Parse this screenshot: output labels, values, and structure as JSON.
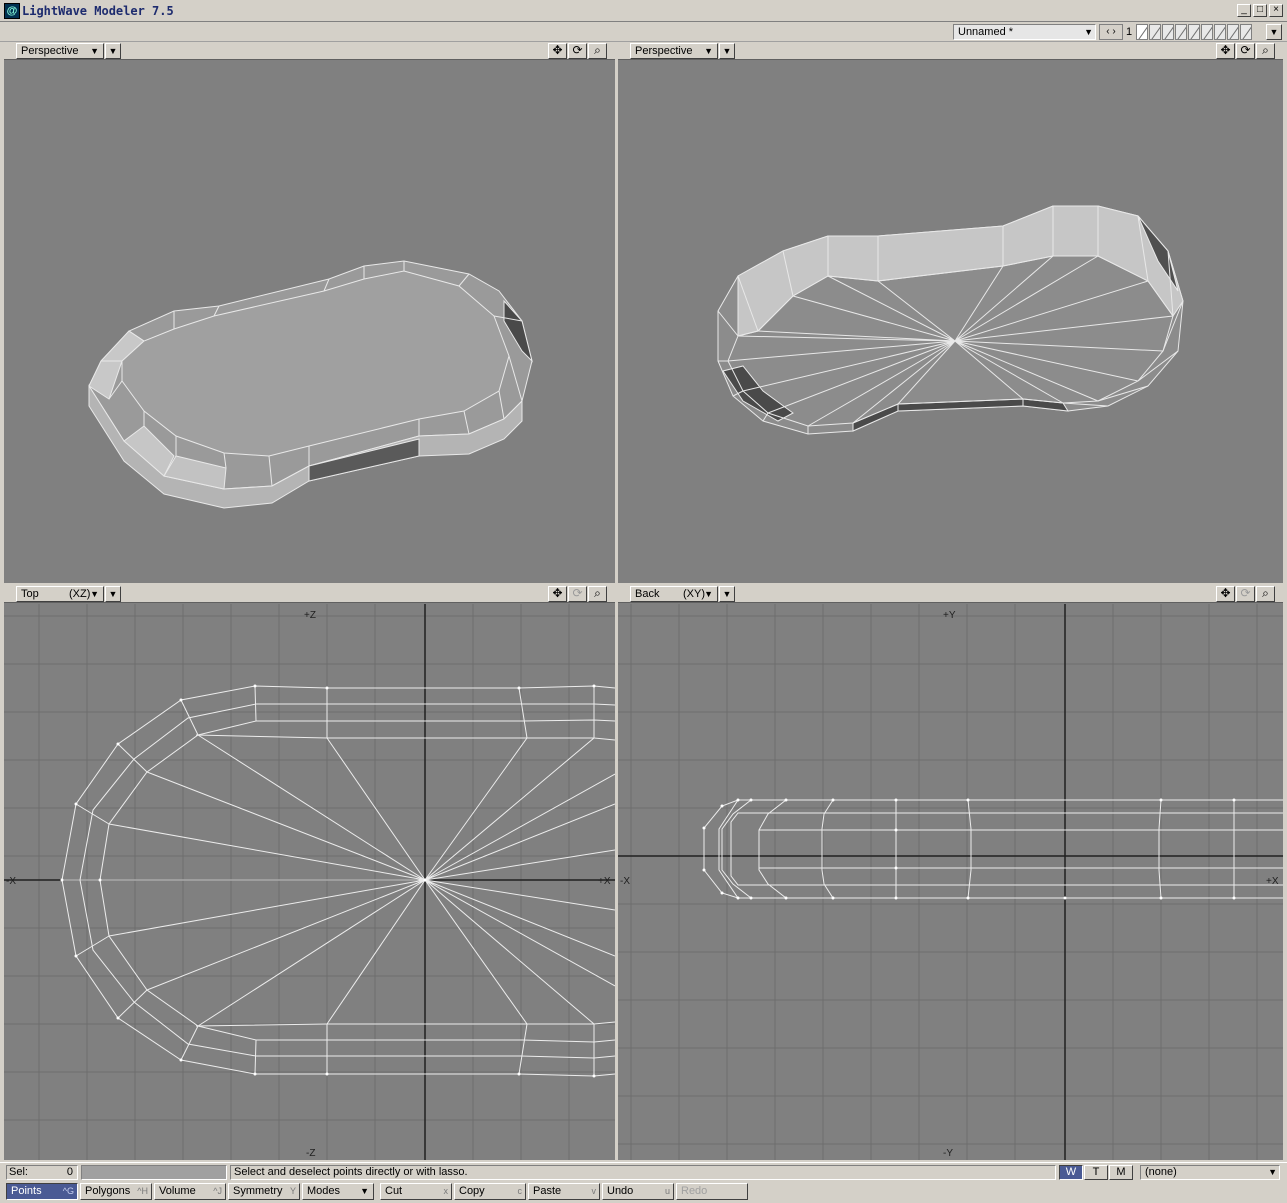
{
  "window": {
    "title": "LightWave Modeler 7.5",
    "icon": "lightwave-app-icon",
    "buttons": [
      "minimize",
      "maximize",
      "close"
    ]
  },
  "top_bar": {
    "object_name": "Unnamed *",
    "layer_number": "1"
  },
  "viewports": [
    {
      "name": "Perspective",
      "axis": "",
      "tools": [
        "move-view-icon",
        "rotate-view-icon",
        "zoom-view-icon"
      ]
    },
    {
      "name": "Perspective",
      "axis": "",
      "tools": [
        "move-view-icon",
        "rotate-view-icon",
        "zoom-view-icon"
      ]
    },
    {
      "name": "Top",
      "axis": "(XZ)",
      "tools": [
        "move-view-icon",
        "rotate-view-icon",
        "zoom-view-icon"
      ],
      "axis_labels": {
        "top": "+Z",
        "bottom": "-Z",
        "left": "-X",
        "right": "+X"
      }
    },
    {
      "name": "Back",
      "axis": "(XY)",
      "tools": [
        "move-view-icon",
        "rotate-view-icon",
        "zoom-view-icon"
      ],
      "axis_labels": {
        "top": "+Y",
        "bottom": "-Y",
        "left": "-X",
        "right": "+X"
      }
    }
  ],
  "status": {
    "sel_label": "Sel:",
    "sel_count": "0",
    "help_text": "Select and deselect points directly or with lasso.",
    "modes": [
      "W",
      "T",
      "M"
    ],
    "active_mode": "W",
    "surface": "(none)"
  },
  "toolbar": {
    "items": [
      {
        "label": "Points",
        "key": "^G",
        "active": true
      },
      {
        "label": "Polygons",
        "key": "^H"
      },
      {
        "label": "Volume",
        "key": "^J"
      },
      {
        "label": "Symmetry",
        "key": "Y"
      },
      {
        "label": "Modes",
        "key": ""
      },
      {
        "label": "Cut",
        "key": "x"
      },
      {
        "label": "Copy",
        "key": "c"
      },
      {
        "label": "Paste",
        "key": "v"
      },
      {
        "label": "Undo",
        "key": "u"
      },
      {
        "label": "Redo",
        "key": "",
        "disabled": true
      }
    ]
  },
  "colors": {
    "ui_gray": "#d4d0c8",
    "viewport_bg": "#808080",
    "grid_line": "#6c6c6c",
    "wire": "#e8e8e8",
    "active_blue": "#4a5a94"
  }
}
